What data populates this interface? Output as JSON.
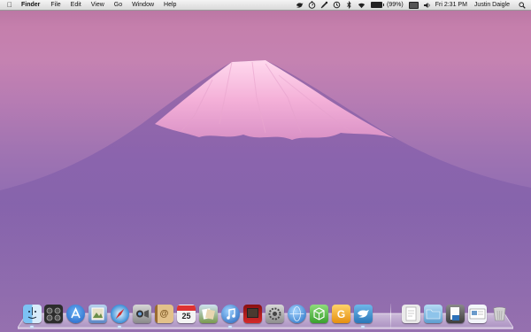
{
  "menubar": {
    "app_name": "Finder",
    "menus": [
      "File",
      "Edit",
      "View",
      "Go",
      "Window",
      "Help"
    ],
    "battery_text": "(99%)",
    "battery_level": 0.99,
    "clock": "Fri 2:31 PM",
    "user_name": "Justin Daigle",
    "status_icons": [
      "bird-icon",
      "stopwatch-icon",
      "script-icon",
      "time-machine-icon",
      "bluetooth-icon",
      "wifi-icon",
      "battery-icon",
      "display-icon",
      "volume-icon",
      "spotlight-icon"
    ]
  },
  "dock": {
    "apps": [
      {
        "icon": "finder-icon",
        "color": "#5aa3e6"
      },
      {
        "icon": "dashboard-icon",
        "color": "#2b2b2b"
      },
      {
        "icon": "app-store-icon",
        "color": "#2f7ad6"
      },
      {
        "icon": "preview-icon",
        "color": "#5b86c4"
      },
      {
        "icon": "safari-icon",
        "color": "#3a8fd8"
      },
      {
        "icon": "facetime-icon",
        "color": "#8e8e8e"
      },
      {
        "icon": "address-book-icon",
        "color": "#c89a52"
      },
      {
        "icon": "ical-icon",
        "color": "#f2f2f2",
        "label": "25"
      },
      {
        "icon": "iphoto-icon",
        "color": "#7a9a4e"
      },
      {
        "icon": "itunes-icon",
        "color": "#2b73c8"
      },
      {
        "icon": "photo-booth-icon",
        "color": "#b31b1b"
      },
      {
        "icon": "system-preferences-icon",
        "color": "#9a9a9a"
      },
      {
        "icon": "network-globe-icon",
        "color": "#3b83d0"
      },
      {
        "icon": "3d-box-app-icon",
        "color": "#58b94d"
      },
      {
        "icon": "g-app-icon",
        "color": "#f0a623"
      },
      {
        "icon": "twitter-icon",
        "color": "#3f8ec9"
      }
    ],
    "stacks": [
      {
        "icon": "document-stack-icon",
        "color": "#e9e9e9"
      },
      {
        "icon": "applications-folder-icon",
        "color": "#7fb8e0"
      },
      {
        "icon": "downloads-stack-icon",
        "color": "#5d5d5d"
      },
      {
        "icon": "document-preview-icon",
        "color": "#e7eef6"
      },
      {
        "icon": "trash-icon",
        "color": "#bfbfbf"
      }
    ]
  }
}
